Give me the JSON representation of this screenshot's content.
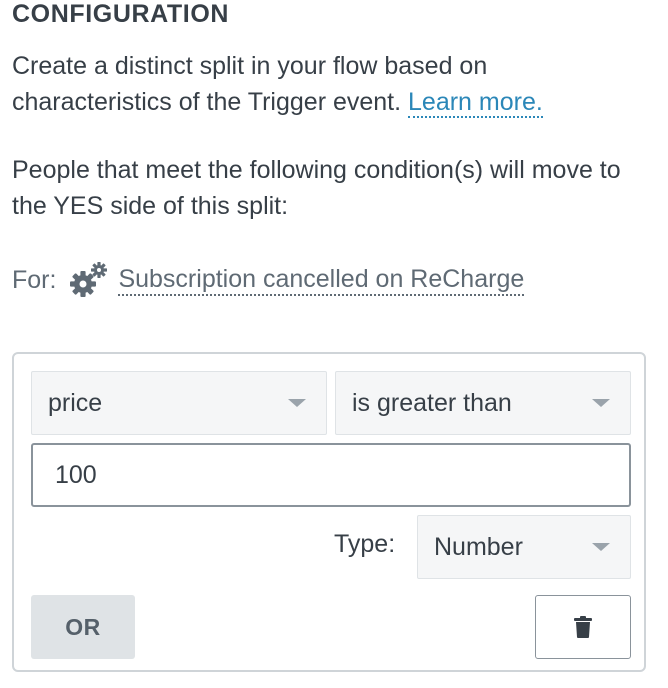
{
  "section": {
    "heading": "CONFIGURATION",
    "description": "Create a distinct split in your flow based on characteristics of the Trigger event.",
    "learn_more": "Learn more.",
    "condition_intro": "People that meet the following condition(s) will move to the YES side of this split:"
  },
  "trigger": {
    "for_label": "For:",
    "icon": "gears-icon",
    "event_name": "Subscription cancelled on ReCharge"
  },
  "condition": {
    "field": "price",
    "operator": "is greater than",
    "value": "100",
    "type_label": "Type:",
    "type_value": "Number"
  },
  "actions": {
    "or_label": "OR",
    "delete_icon": "trash-icon"
  },
  "colors": {
    "text": "#373f47",
    "link": "#2b87b8",
    "muted": "#5f6a74",
    "panel_border": "#cfd4d8",
    "select_bg": "#f5f6f7",
    "or_bg": "#dfe3e6"
  }
}
